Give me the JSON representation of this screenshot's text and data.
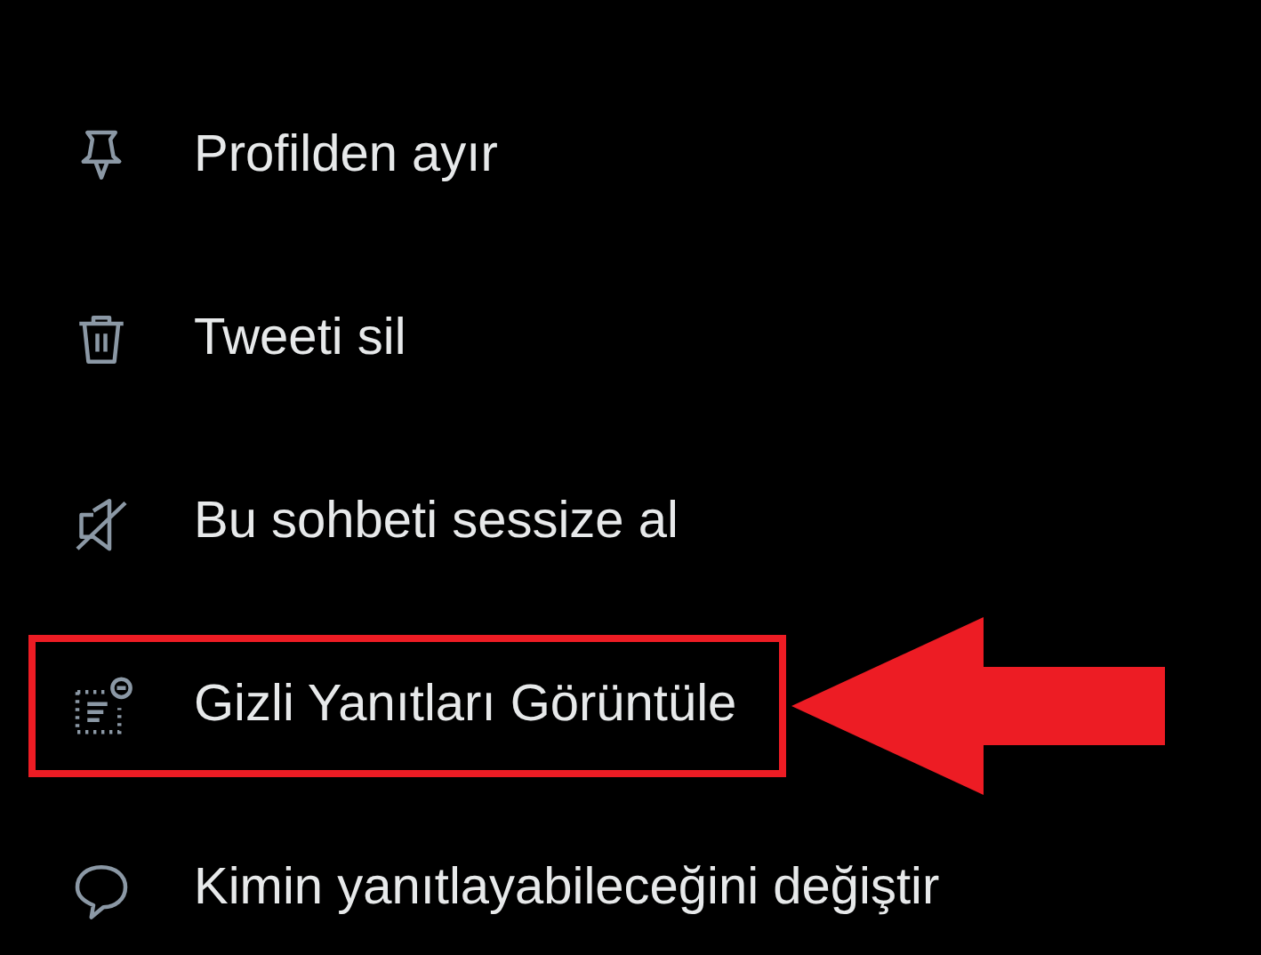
{
  "menu": {
    "items": [
      {
        "kind": "pin",
        "label": "Profilden ayır",
        "highlighted": false
      },
      {
        "kind": "trash",
        "label": "Tweeti sil",
        "highlighted": false
      },
      {
        "kind": "mute",
        "label": "Bu sohbeti sessize al",
        "highlighted": false
      },
      {
        "kind": "hidden-replies",
        "label": "Gizli Yanıtları Görüntüle",
        "highlighted": true
      },
      {
        "kind": "reply",
        "label": "Kimin yanıtlayabileceğini değiştir",
        "highlighted": false
      }
    ]
  }
}
